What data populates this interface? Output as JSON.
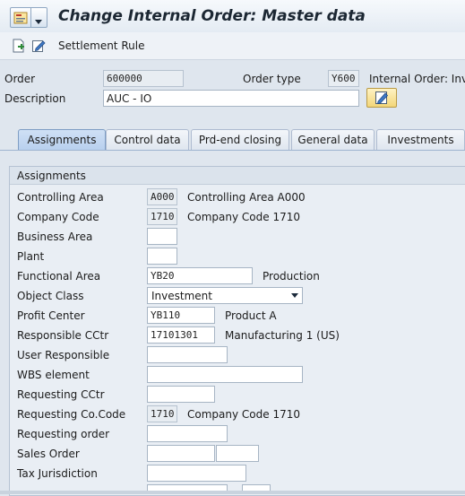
{
  "window": {
    "title": "Change Internal Order: Master data"
  },
  "toolbar": {
    "settlement_label": "Settlement Rule"
  },
  "header": {
    "order_label": "Order",
    "order_value": "600000",
    "order_type_label": "Order type",
    "order_type_value": "Y600",
    "order_type_text": "Internal Order: Inve",
    "description_label": "Description",
    "description_value": "AUC - IO"
  },
  "tabs": [
    {
      "label": "Assignments",
      "active": true
    },
    {
      "label": "Control data"
    },
    {
      "label": "Prd-end closing"
    },
    {
      "label": "General data"
    },
    {
      "label": "Investments"
    }
  ],
  "assignments": {
    "section_title": "Assignments",
    "controlling_area_label": "Controlling Area",
    "controlling_area_value": "A000",
    "controlling_area_text": "Controlling Area A000",
    "company_code_label": "Company Code",
    "company_code_value": "1710",
    "company_code_text": "Company Code 1710",
    "business_area_label": "Business Area",
    "business_area_value": "",
    "plant_label": "Plant",
    "plant_value": "",
    "functional_area_label": "Functional Area",
    "functional_area_value": "YB20",
    "functional_area_text": "Production",
    "object_class_label": "Object Class",
    "object_class_value": "Investment",
    "profit_center_label": "Profit Center",
    "profit_center_value": "YB110",
    "profit_center_text": "Product A",
    "responsible_cctr_label": "Responsible CCtr",
    "responsible_cctr_value": "17101301",
    "responsible_cctr_text": "Manufacturing 1 (US)",
    "user_responsible_label": "User Responsible",
    "user_responsible_value": "",
    "wbs_element_label": "WBS element",
    "wbs_element_value": "",
    "requesting_cctr_label": "Requesting CCtr",
    "requesting_cctr_value": "",
    "requesting_cocode_label": "Requesting Co.Code",
    "requesting_cocode_value": "1710",
    "requesting_cocode_text": "Company Code 1710",
    "requesting_order_label": "Requesting order",
    "requesting_order_value": "",
    "sales_order_label": "Sales Order",
    "sales_order_value": "",
    "sales_order_item_value": "",
    "tax_jurisdiction_label": "Tax Jurisdiction",
    "tax_jurisdiction_value": ""
  },
  "colors": {
    "accent": "#1c2733",
    "tab_active": "#b7cfee",
    "edit_button": "#f3d679"
  }
}
